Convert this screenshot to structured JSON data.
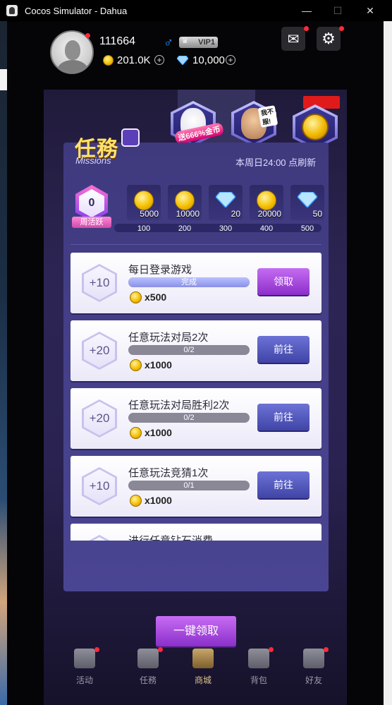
{
  "window": {
    "title": "Cocos Simulator - Dahua",
    "minimize": "—",
    "maximize": "☐",
    "close": "✕"
  },
  "user": {
    "id": "111664",
    "gender_symbol": "♂",
    "vip": "VIP1",
    "coins": "201.0K",
    "diamonds": "10,000",
    "plus": "+"
  },
  "header_buttons": [
    {
      "name": "mail-button",
      "icon": "mail-icon",
      "glyph": "✉"
    },
    {
      "name": "settings-button",
      "icon": "gear-icon",
      "glyph": "⚙"
    }
  ],
  "promos": [
    {
      "label": "送666%金币",
      "icon": "lucky-cat-icon"
    },
    {
      "label": "我不服!",
      "icon": "character-face-icon"
    },
    {
      "label": "",
      "icon": "coin-pile-icon"
    }
  ],
  "panel": {
    "title": "任務",
    "subtitle": "Missions",
    "reset_note": "本周日24:00 点刷新",
    "weekly_activity": {
      "value": "0",
      "label": "周活跃",
      "progress_fraction": 0
    },
    "rewards": [
      {
        "type": "coin",
        "amount": "5000",
        "threshold": "100"
      },
      {
        "type": "coin",
        "amount": "10000",
        "threshold": "200"
      },
      {
        "type": "diamond",
        "amount": "20",
        "threshold": "300"
      },
      {
        "type": "coin",
        "amount": "20000",
        "threshold": "400"
      },
      {
        "type": "diamond",
        "amount": "50",
        "threshold": "500"
      }
    ],
    "missions": [
      {
        "points": "+10",
        "title": "每日登录游戏",
        "progress_text": "完成",
        "progress_fraction": 1.0,
        "reward": "x500",
        "button": "领取",
        "state": "claim"
      },
      {
        "points": "+20",
        "title": "任意玩法对局2次",
        "progress_text": "0/2",
        "progress_fraction": 0,
        "reward": "x1000",
        "button": "前往",
        "state": "go"
      },
      {
        "points": "+20",
        "title": "任意玩法对局胜利2次",
        "progress_text": "0/2",
        "progress_fraction": 0,
        "reward": "x1000",
        "button": "前往",
        "state": "go"
      },
      {
        "points": "+10",
        "title": "任意玩法竞猜1次",
        "progress_text": "0/1",
        "progress_fraction": 0,
        "reward": "x1000",
        "button": "前往",
        "state": "go"
      },
      {
        "points": "",
        "title": "进行任意钻石消费",
        "progress_text": "",
        "progress_fraction": 0,
        "reward": "",
        "button": "",
        "state": "go"
      }
    ],
    "claim_all": "一键领取"
  },
  "nav": [
    {
      "label": "活动",
      "icon": "activity-icon",
      "badge": true,
      "active": false
    },
    {
      "label": "任務",
      "icon": "calendar-task-icon",
      "badge": true,
      "active": false
    },
    {
      "label": "商城",
      "icon": "shop-cart-icon",
      "badge": false,
      "active": true
    },
    {
      "label": "背包",
      "icon": "backpack-icon",
      "badge": true,
      "active": false
    },
    {
      "label": "好友",
      "icon": "friends-icon",
      "badge": true,
      "active": false
    }
  ],
  "colors": {
    "accent_purple": "#8c2fc9",
    "go_button": "#3f44a6",
    "badge_red": "#ff2a3a",
    "gold": "#f5c000",
    "male_blue": "#2f9bff"
  }
}
